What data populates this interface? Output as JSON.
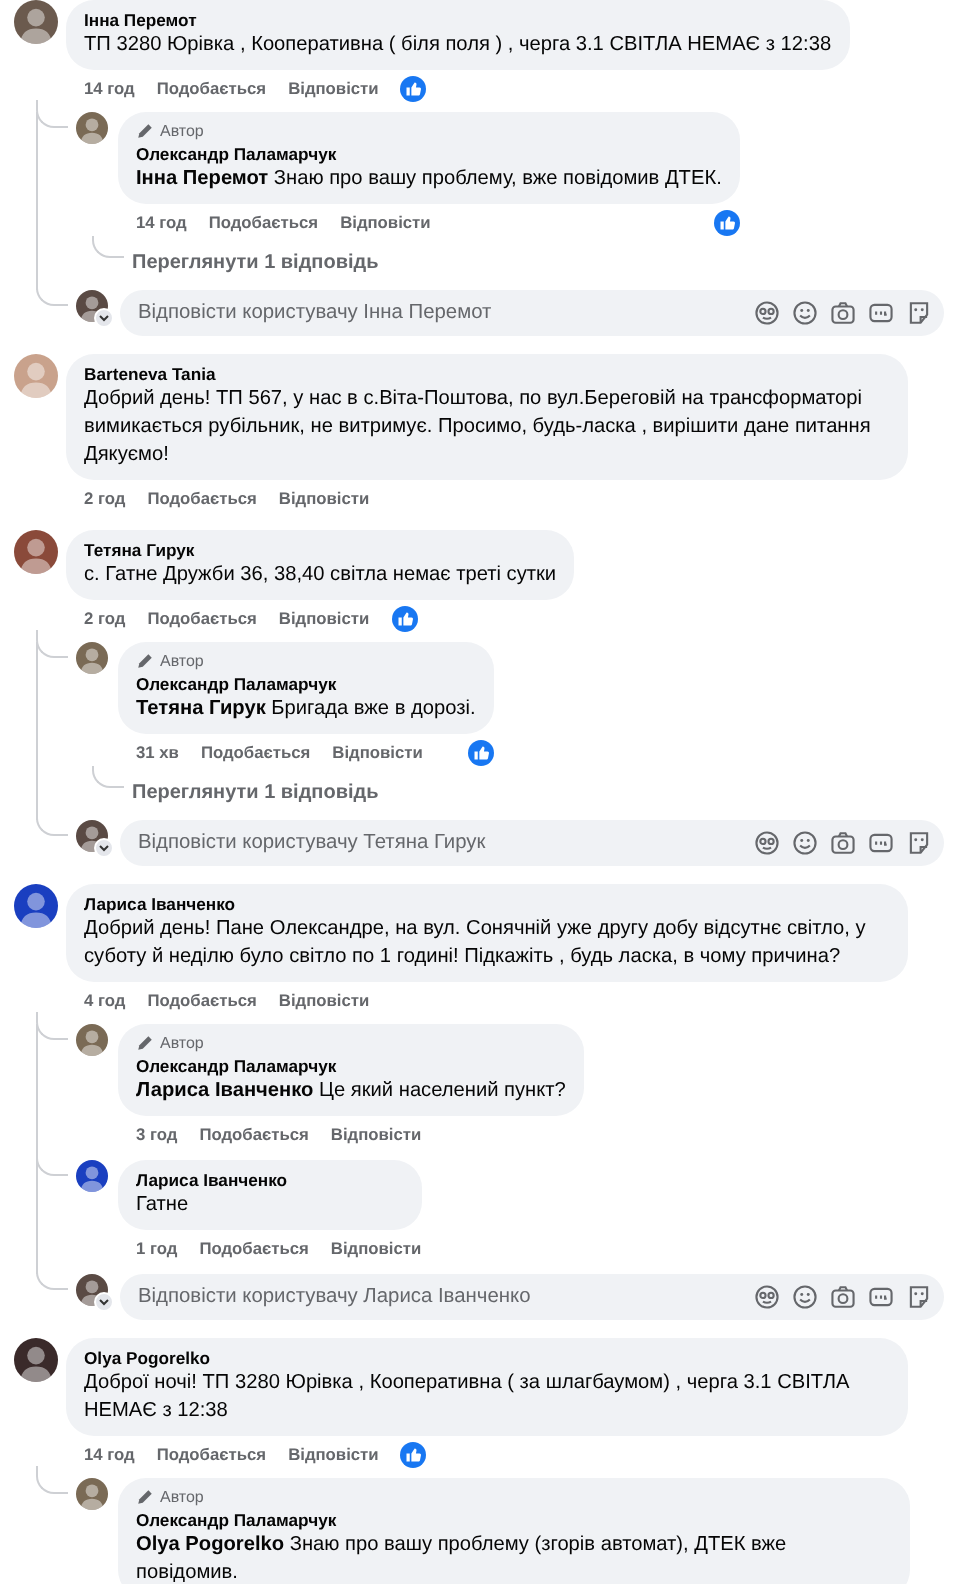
{
  "threads": [
    {
      "comment": {
        "author": "Інна Перемот",
        "color": "#6b5a4e",
        "text": "ТП 3280 Юрівка , Кооперативна ( біля поля ) , черга 3.1 СВІТЛА НЕМАЄ з 12:38",
        "time": "14 год",
        "like": "Подобається",
        "reply": "Відповісти",
        "reacted": true
      },
      "replies": [
        {
          "badge": "Автор",
          "author": "Олександр Паламарчук",
          "color": "#7a6a55",
          "text": "**Інна Перемот** Знаю про вашу проблему, вже повідомив ДТЕК.",
          "time": "14 год",
          "like": "Подобається",
          "reply": "Відповісти",
          "reacted": true,
          "more_replies": "Переглянути 1 відповідь"
        }
      ],
      "reply_box": {
        "placeholder": "Відповісти користувачу Інна Перемот"
      }
    },
    {
      "comment": {
        "author": "Barteneva Tania",
        "color": "#c9a28c",
        "text": "Добрий день! ТП 567, у нас в с.Віта-Поштова, по вул.Береговій на трансформаторі вимикається рубільник, не витримує. Просимо, будь-ласка , вирішити дане питання\nДякуємо!",
        "time": "2 год",
        "like": "Подобається",
        "reply": "Відповісти",
        "reacted": false
      }
    },
    {
      "comment": {
        "author": "Тетяна Гирук",
        "color": "#8a4a3a",
        "text": "с. Гатне Дружби 36, 38,40 світла немає треті сутки",
        "time": "2 год",
        "like": "Подобається",
        "reply": "Відповісти",
        "reacted": true
      },
      "replies": [
        {
          "badge": "Автор",
          "author": "Олександр Паламарчук",
          "color": "#7a6a55",
          "text": "**Тетяна Гирук** Бригада вже в дорозі.",
          "time": "31 хв",
          "like": "Подобається",
          "reply": "Відповісти",
          "reacted": true,
          "more_replies": "Переглянути 1 відповідь"
        }
      ],
      "reply_box": {
        "placeholder": "Відповісти користувачу Тетяна Гирук"
      }
    },
    {
      "comment": {
        "author": "Лариса Іванченко",
        "color": "#1a3fc0",
        "text": "Добрий день! Пане Олександре, на вул. Сонячній уже другу добу відсутнє світло, у суботу й неділю було світло по 1 годині! Підкажіть , будь ласка, в чому причина?",
        "time": "4 год",
        "like": "Подобається",
        "reply": "Відповісти",
        "reacted": false
      },
      "replies": [
        {
          "badge": "Автор",
          "author": "Олександр Паламарчук",
          "color": "#7a6a55",
          "text": "**Лариса Іванченко** Це який населений пункт?",
          "time": "3 год",
          "like": "Подобається",
          "reply": "Відповісти",
          "reacted": false
        },
        {
          "author": "Лариса Іванченко",
          "color": "#1a3fc0",
          "text": "Гатне",
          "time": "1 год",
          "like": "Подобається",
          "reply": "Відповісти",
          "reacted": false
        }
      ],
      "reply_box": {
        "placeholder": "Відповісти користувачу Лариса Іванченко"
      }
    },
    {
      "comment": {
        "author": "Olya Pogorelko",
        "color": "#3a2a2a",
        "text": "Доброї ночі! ТП 3280 Юрівка , Кооперативна ( за шлагбаумом) , черга 3.1 СВІТЛА НЕМАЄ з 12:38",
        "time": "14 год",
        "like": "Подобається",
        "reply": "Відповісти",
        "reacted": true
      },
      "replies": [
        {
          "badge": "Автор",
          "author": "Олександр Паламарчук",
          "color": "#7a6a55",
          "text": "**Olya Pogorelko** Знаю про вашу проблему (згорів автомат), ДТЕК вже повідомив."
        }
      ]
    }
  ]
}
